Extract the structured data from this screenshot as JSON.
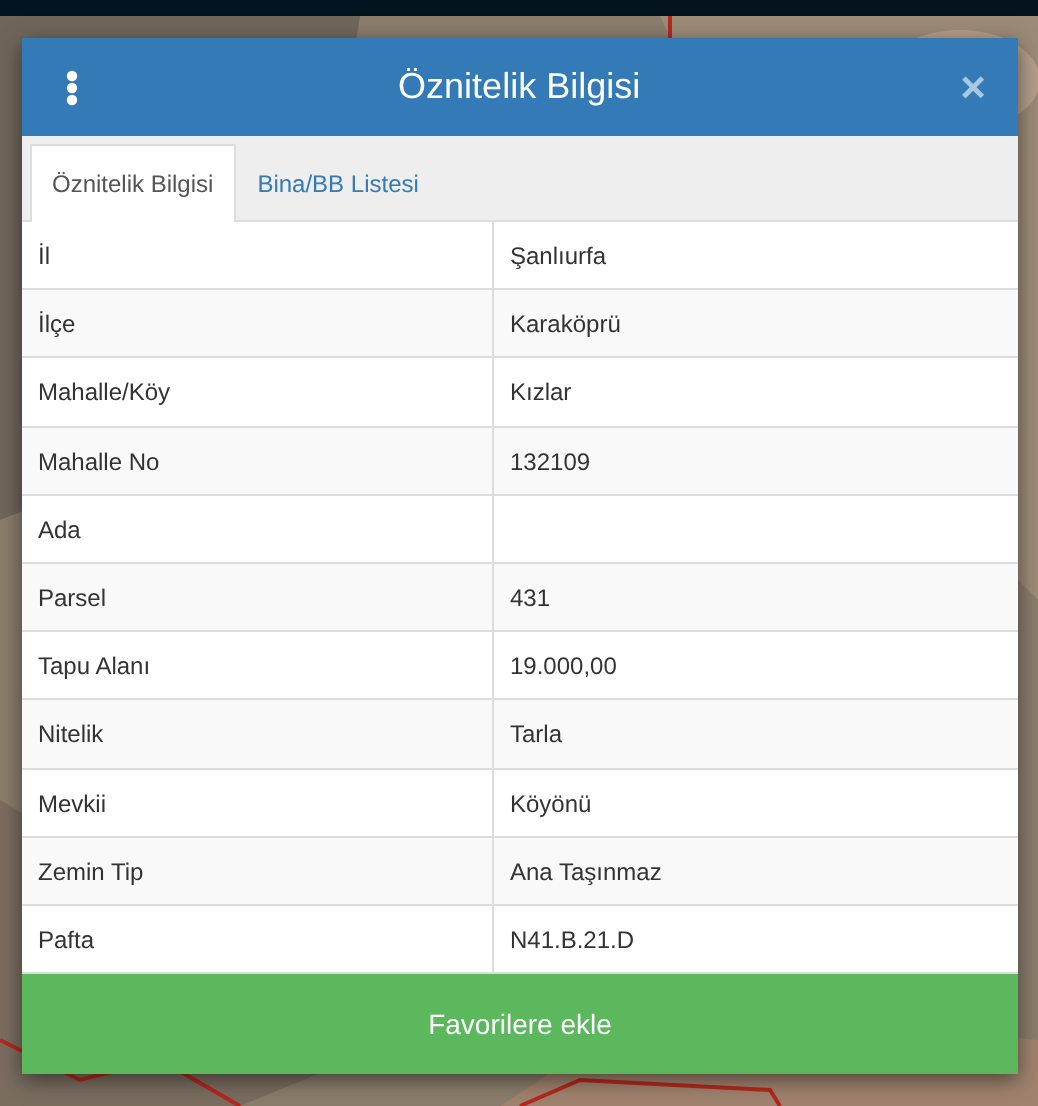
{
  "dialog": {
    "title": "Öznitelik Bilgisi",
    "close": "×"
  },
  "tabs": [
    {
      "label": "Öznitelik Bilgisi",
      "selected": true
    },
    {
      "label": "Bina/BB Listesi",
      "selected": false
    }
  ],
  "rows": [
    {
      "label": "İl",
      "value": "Şanlıurfa"
    },
    {
      "label": "İlçe",
      "value": "Karaköprü"
    },
    {
      "label": "Mahalle/Köy",
      "value": "Kızlar"
    },
    {
      "label": "Mahalle No",
      "value": "132109"
    },
    {
      "label": "Ada",
      "value": ""
    },
    {
      "label": "Parsel",
      "value": "431"
    },
    {
      "label": "Tapu Alanı",
      "value": "19.000,00"
    },
    {
      "label": "Nitelik",
      "value": "Tarla"
    },
    {
      "label": "Mevkii",
      "value": "Köyönü"
    },
    {
      "label": "Zemin Tip",
      "value": "Ana Taşınmaz"
    },
    {
      "label": "Pafta",
      "value": "N41.B.21.D"
    }
  ],
  "button": {
    "label": "Favorilere ekle"
  }
}
